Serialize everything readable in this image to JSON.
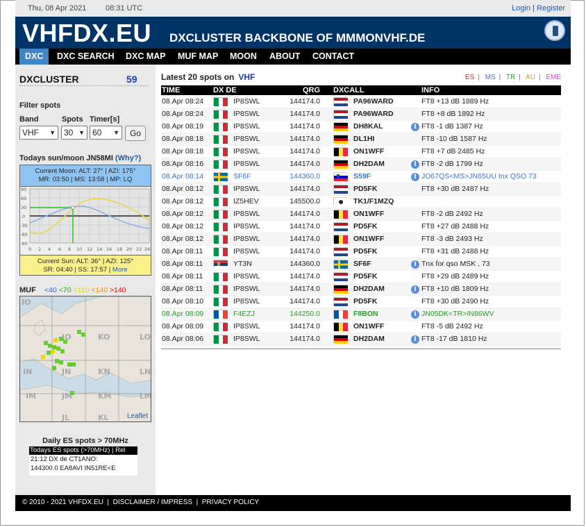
{
  "topbar": {
    "date": "Thu, 08 Apr 2021",
    "time": "08:31 UTC",
    "login": "Login",
    "separator": "|",
    "register": "Register"
  },
  "header": {
    "logo": "VHFDX.EU",
    "tagline": "DXCLUSTER BACKBONE OF MMMONVHF.DE",
    "icon": "mobile-phone-icon"
  },
  "nav": [
    "DXC",
    "DXC SEARCH",
    "DXC MAP",
    "MUF MAP",
    "MOON",
    "ABOUT",
    "CONTACT"
  ],
  "sidebar": {
    "title": "DXCLUSTER",
    "count": "59",
    "filter_title": "Filter spots",
    "band_label": "Band",
    "band_value": "VHF",
    "spots_label": "Spots",
    "spots_value": "30",
    "timer_label": "Timer[s]",
    "timer_value": "60",
    "go": "Go",
    "sun_title": "Todays sun/moon JN58MI",
    "why": "(Why?)",
    "moon_line1": "Current Moon:   ALT: 27°   |   AZI: 175°",
    "moon_line2": "MR: 03:50   |   MS: 13:58   |   MP: LQ",
    "y_ticks": [
      "90",
      "60",
      "30",
      "0",
      "-30",
      "-60",
      "-90"
    ],
    "x_ticks": [
      "0",
      "2",
      "4",
      "6",
      "8",
      "10",
      "12",
      "14",
      "16",
      "18",
      "20",
      "22",
      "24"
    ],
    "sun_line1": "Current Sun:   ALT: 36°   |   AZI: 125°",
    "sun_line2": "SR: 04:40   |   SS: 17:57   |",
    "more": "More",
    "muf_title": "MUF",
    "muf_legend": [
      "<40",
      "<70",
      "<110",
      "<140",
      ">140"
    ],
    "muf_colors": [
      "#3366cc",
      "#22aa22",
      "#e6d800",
      "#ff8800",
      "#ee0000"
    ],
    "map_grid_labels": [
      "IO",
      "JO",
      "KO",
      "LO",
      "IN",
      "JN",
      "KN",
      "LN",
      "IM",
      "JM",
      "KM",
      "LM",
      "JL",
      "KL"
    ],
    "leaflet": "Leaflet",
    "es_title": "Daily ES spots > 70MHz",
    "es_header": "Todays ES spots (>70MHz) | Rel",
    "es_lines": [
      "21:12   DX de CT1ANO:",
      "144300.0    EA8AVI    IN51RE<E"
    ]
  },
  "content": {
    "title": "Latest 20 spots on",
    "band": "VHF",
    "band_filters": [
      {
        "label": "ES",
        "color": "#d62020"
      },
      {
        "label": "MS",
        "color": "#3c73c9"
      },
      {
        "label": "TR",
        "color": "#2a9a2a"
      },
      {
        "label": "AU",
        "color": "#d69a00"
      },
      {
        "label": "EME",
        "color": "#cc44cc"
      }
    ],
    "columns": [
      "TIME",
      "DX DE",
      "QRG",
      "DXCALL",
      "INFO"
    ],
    "spots": [
      {
        "time": "08.Apr 08:24",
        "de_flag": "it",
        "de": "IP8SWL",
        "qrg": "144174.0",
        "dx_flag": "nl",
        "dx": "PA96WARD",
        "info_icon": false,
        "info": "FT8 +13 dB 1889 Hz",
        "style": ""
      },
      {
        "time": "08.Apr 08:24",
        "de_flag": "it",
        "de": "IP8SWL",
        "qrg": "144174.0",
        "dx_flag": "nl",
        "dx": "PA96WARD",
        "info_icon": false,
        "info": "FT8 +8 dB 1892 Hz",
        "style": ""
      },
      {
        "time": "08.Apr 08:19",
        "de_flag": "it",
        "de": "IP8SWL",
        "qrg": "144174.0",
        "dx_flag": "de",
        "dx": "DH8KAL",
        "info_icon": true,
        "info": "FT8 -1 dB 1387 Hz",
        "style": ""
      },
      {
        "time": "08.Apr 08:18",
        "de_flag": "it",
        "de": "IP8SWL",
        "qrg": "144174.0",
        "dx_flag": "de",
        "dx": "DL1HI",
        "info_icon": false,
        "info": "FT8 -10 dB 1587 Hz",
        "style": ""
      },
      {
        "time": "08.Apr 08:18",
        "de_flag": "it",
        "de": "IP8SWL",
        "qrg": "144174.0",
        "dx_flag": "be",
        "dx": "ON1WFF",
        "info_icon": false,
        "info": "FT8 +7 dB 2485 Hz",
        "style": ""
      },
      {
        "time": "08.Apr 08:16",
        "de_flag": "it",
        "de": "IP8SWL",
        "qrg": "144174.0",
        "dx_flag": "de",
        "dx": "DH2DAM",
        "info_icon": true,
        "info": "FT8 -2 dB 1799 Hz",
        "style": ""
      },
      {
        "time": "08.Apr 08:14",
        "de_flag": "se",
        "de": "SF6F",
        "qrg": "144360.0",
        "dx_flag": "si",
        "dx": "S59F",
        "info_icon": true,
        "info": "JO67QS<MS>JN65UU tnx QSO 73",
        "style": "blue"
      },
      {
        "time": "08.Apr 08:12",
        "de_flag": "it",
        "de": "IP8SWL",
        "qrg": "144174.0",
        "dx_flag": "nl",
        "dx": "PD5FK",
        "info_icon": false,
        "info": "FT8 +30 dB 2487 Hz",
        "style": ""
      },
      {
        "time": "08.Apr 08:12",
        "de_flag": "it",
        "de": "IZ5HEV",
        "qrg": "145500.0",
        "dx_flag": "corsica",
        "dx": "TK1/F1MZQ",
        "info_icon": false,
        "info": "",
        "style": ""
      },
      {
        "time": "08.Apr 08:12",
        "de_flag": "it",
        "de": "IP8SWL",
        "qrg": "144174.0",
        "dx_flag": "be",
        "dx": "ON1WFF",
        "info_icon": false,
        "info": "FT8 -2 dB 2492 Hz",
        "style": ""
      },
      {
        "time": "08.Apr 08:12",
        "de_flag": "it",
        "de": "IP8SWL",
        "qrg": "144174.0",
        "dx_flag": "nl",
        "dx": "PD5FK",
        "info_icon": false,
        "info": "FT8 +27 dB 2488 Hz",
        "style": ""
      },
      {
        "time": "08.Apr 08:12",
        "de_flag": "it",
        "de": "IP8SWL",
        "qrg": "144174.0",
        "dx_flag": "be",
        "dx": "ON1WFF",
        "info_icon": false,
        "info": "FT8 -3 dB 2493 Hz",
        "style": ""
      },
      {
        "time": "08.Apr 08:11",
        "de_flag": "it",
        "de": "IP8SWL",
        "qrg": "144174.0",
        "dx_flag": "nl",
        "dx": "PD5FK",
        "info_icon": false,
        "info": "FT8 +31 dB 2488 Hz",
        "style": ""
      },
      {
        "time": "08.Apr 08:11",
        "de_flag": "rs",
        "de": "YT3N",
        "qrg": "144360.0",
        "dx_flag": "se",
        "dx": "SF6F",
        "info_icon": true,
        "info": "Tnx for qso MSK , 73",
        "style": ""
      },
      {
        "time": "08.Apr 08:11",
        "de_flag": "it",
        "de": "IP8SWL",
        "qrg": "144174.0",
        "dx_flag": "nl",
        "dx": "PD5FK",
        "info_icon": false,
        "info": "FT8 +29 dB 2489 Hz",
        "style": ""
      },
      {
        "time": "08.Apr 08:11",
        "de_flag": "it",
        "de": "IP8SWL",
        "qrg": "144174.0",
        "dx_flag": "de",
        "dx": "DH2DAM",
        "info_icon": true,
        "info": "FT8 +10 dB 1809 Hz",
        "style": ""
      },
      {
        "time": "08.Apr 08:10",
        "de_flag": "it",
        "de": "IP8SWL",
        "qrg": "144174.0",
        "dx_flag": "nl",
        "dx": "PD5FK",
        "info_icon": false,
        "info": "FT8 +30 dB 2490 Hz",
        "style": ""
      },
      {
        "time": "08.Apr 08:09",
        "de_flag": "fr",
        "de": "F4EZJ",
        "qrg": "144250.0",
        "dx_flag": "fr",
        "dx": "F8BON",
        "info_icon": true,
        "info": "JN05DK<TR>IN86WV",
        "style": "green"
      },
      {
        "time": "08.Apr 08:09",
        "de_flag": "it",
        "de": "IP8SWL",
        "qrg": "144174.0",
        "dx_flag": "be",
        "dx": "ON1WFF",
        "info_icon": false,
        "info": "FT8 -5 dB 2492 Hz",
        "style": ""
      },
      {
        "time": "08.Apr 08:06",
        "de_flag": "it",
        "de": "IP8SWL",
        "qrg": "144174.0",
        "dx_flag": "de",
        "dx": "DH2DAM",
        "info_icon": true,
        "info": "FT8 -17 dB 1810 Hz",
        "style": ""
      }
    ]
  },
  "footer": {
    "copyright": "© 2010 - 2021 VHFDX.EU",
    "disclaimer": "DISCLAIMER / IMPRESS",
    "privacy": "PRIVACY POLICY"
  }
}
